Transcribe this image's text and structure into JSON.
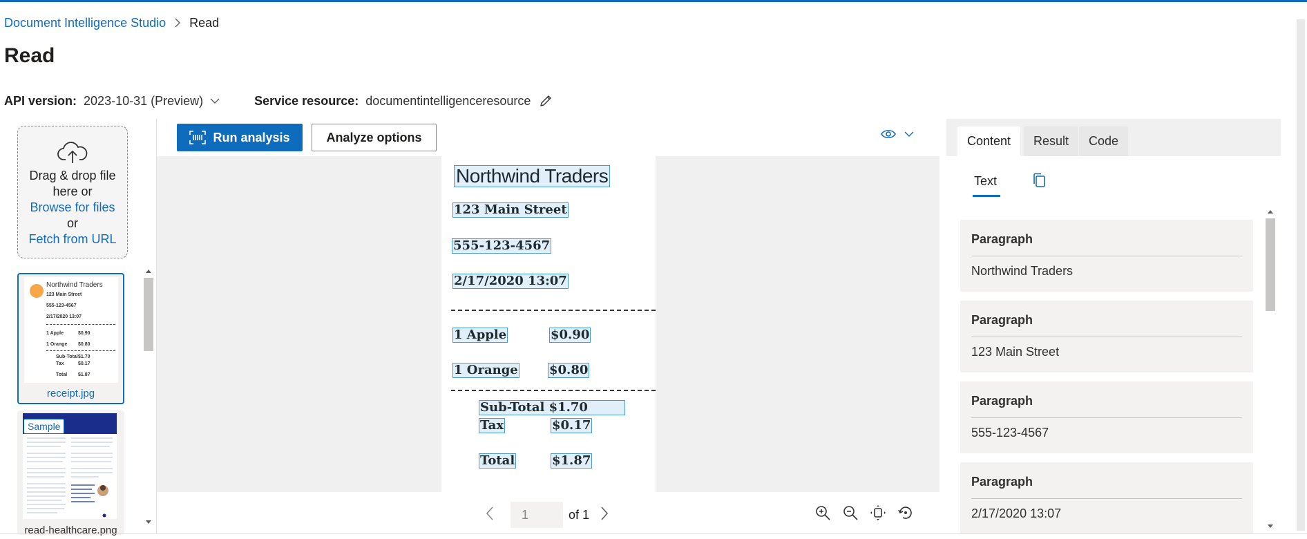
{
  "breadcrumb": {
    "root": "Document Intelligence Studio",
    "current": "Read"
  },
  "page": {
    "title": "Read"
  },
  "meta": {
    "api_label": "API version:",
    "api_value": "2023-10-31 (Preview)",
    "service_label": "Service resource:",
    "service_value": "documentintelligenceresource"
  },
  "dropzone": {
    "line1": "Drag & drop file",
    "line2": "here or",
    "browse": "Browse for files",
    "or": "or",
    "fetch": "Fetch from URL"
  },
  "thumbnails": [
    {
      "label": "receipt.jpg",
      "selected": true
    },
    {
      "label": "read-healthcare.png",
      "badge": "Sample"
    }
  ],
  "thumbnail_receipt_text": {
    "title": "Northwind Traders",
    "address": "123 Main Street",
    "phone": "555-123-4567",
    "datetime": "2/17/2020  13:07",
    "item1": "1 Apple",
    "item1_price": "$0.90",
    "item2": "1 Orange",
    "item2_price": "$0.80",
    "subtotal": "Sub-Total",
    "subtotal_value": "$1.70",
    "tax": "Tax",
    "tax_value": "$0.17",
    "total": "Total",
    "total_value": "$1.87"
  },
  "toolbar": {
    "run_label": "Run analysis",
    "options_label": "Analyze options"
  },
  "document": {
    "title": "Northwind Traders",
    "address": "123 Main Street",
    "phone": "555-123-4567",
    "datetime": "2/17/2020   13:07",
    "item1": "1 Apple",
    "item1_price": "$0.90",
    "item2": "1 Orange",
    "item2_price": "$0.80",
    "subtotal_line": "Sub-Total   $1.70",
    "tax": "Tax",
    "tax_value": "$0.17",
    "total": "Total",
    "total_value": "$1.87"
  },
  "pager": {
    "page_value": "1",
    "of_label": "of 1"
  },
  "tabs": [
    "Content",
    "Result",
    "Code"
  ],
  "active_tab": "Content",
  "subtab": {
    "text": "Text"
  },
  "paragraphs": [
    {
      "heading": "Paragraph",
      "text": "Northwind Traders"
    },
    {
      "heading": "Paragraph",
      "text": "123 Main Street"
    },
    {
      "heading": "Paragraph",
      "text": "555-123-4567"
    },
    {
      "heading": "Paragraph",
      "text": "2/17/2020 13:07"
    }
  ],
  "colors": {
    "accent": "#0f6cbd",
    "highlight_border": "#4a98d6",
    "panel_bg": "#f3f2f1",
    "orange": "#f7a649"
  },
  "icons": [
    "chevron-right-icon",
    "chevron-down-icon",
    "pencil-icon",
    "cloud-upload-icon",
    "scan-icon",
    "eye-icon",
    "chevron-left-icon",
    "zoom-in-icon",
    "zoom-out-icon",
    "fit-page-icon",
    "rotate-icon",
    "copy-icon"
  ]
}
